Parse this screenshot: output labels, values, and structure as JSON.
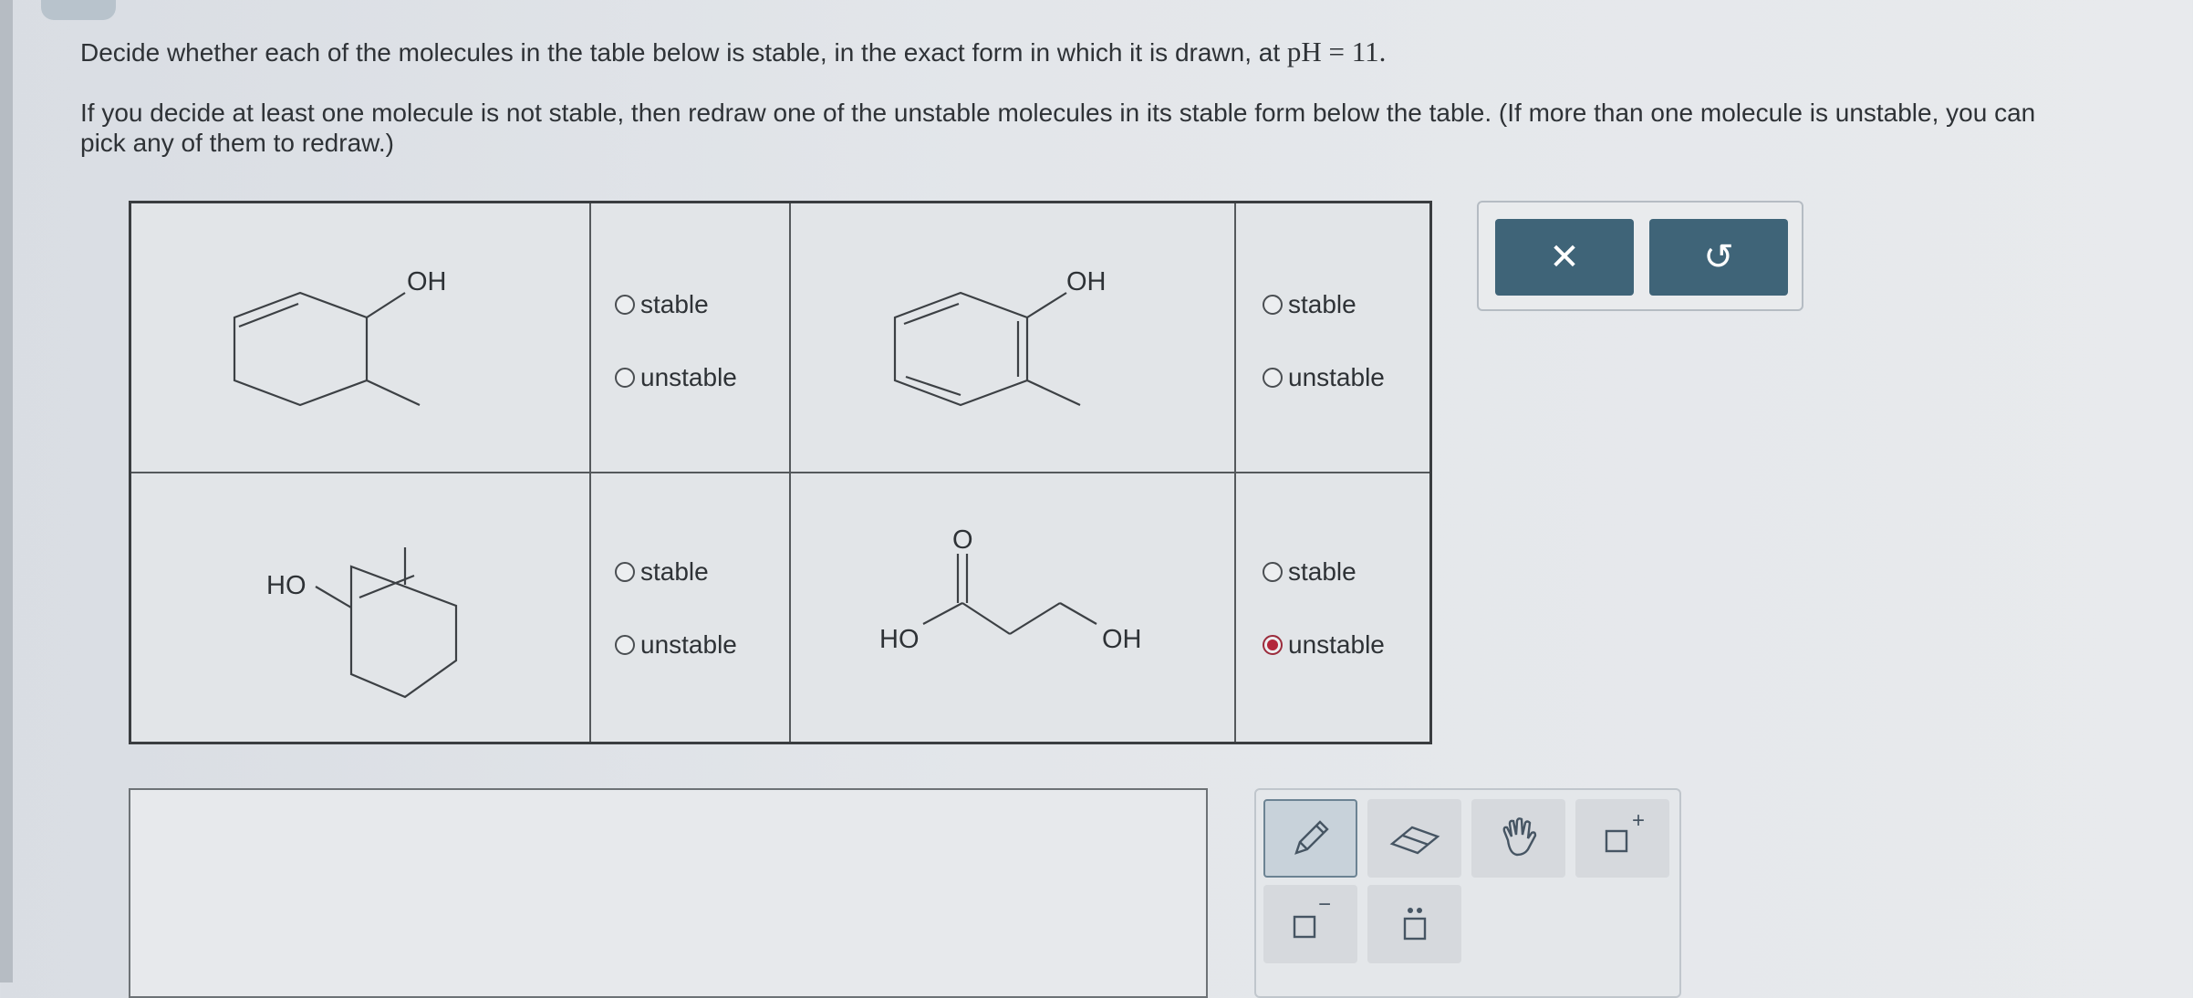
{
  "instructions": {
    "line1_text": "Decide whether each of the molecules in the table below is stable, in the exact form in which it is drawn, at",
    "line1_ph": "pH = 11.",
    "line2": "If you decide at least one molecule is not stable, then redraw one of the unstable molecules in its stable form below the table. (If more than one molecule is unstable, you can pick any of them to redraw.)"
  },
  "labels": {
    "OH": "OH",
    "HO": "HO",
    "O": "O"
  },
  "molecules": [
    {
      "id": "cyclohexenol",
      "options": [
        "stable",
        "unstable"
      ],
      "selected": null
    },
    {
      "id": "cresol",
      "options": [
        "stable",
        "unstable"
      ],
      "selected": null
    },
    {
      "id": "enol-cyclohexene",
      "options": [
        "stable",
        "unstable"
      ],
      "selected": null
    },
    {
      "id": "hydroxy-acid",
      "options": [
        "stable",
        "unstable"
      ],
      "selected": "unstable"
    }
  ],
  "toolbar": {
    "clear_symbol": "✕",
    "undo_symbol": "↺"
  },
  "palette": {
    "tools": [
      "pencil-icon",
      "eraser-icon",
      "hand-icon",
      "add-positive-charge-icon",
      "add-negative-charge-icon",
      "lone-pair-icon"
    ],
    "superscript_plus": "+",
    "superscript_minus": "−"
  },
  "colors": {
    "accent_button": "#3f6478",
    "selected_radio": "#b3263a"
  }
}
